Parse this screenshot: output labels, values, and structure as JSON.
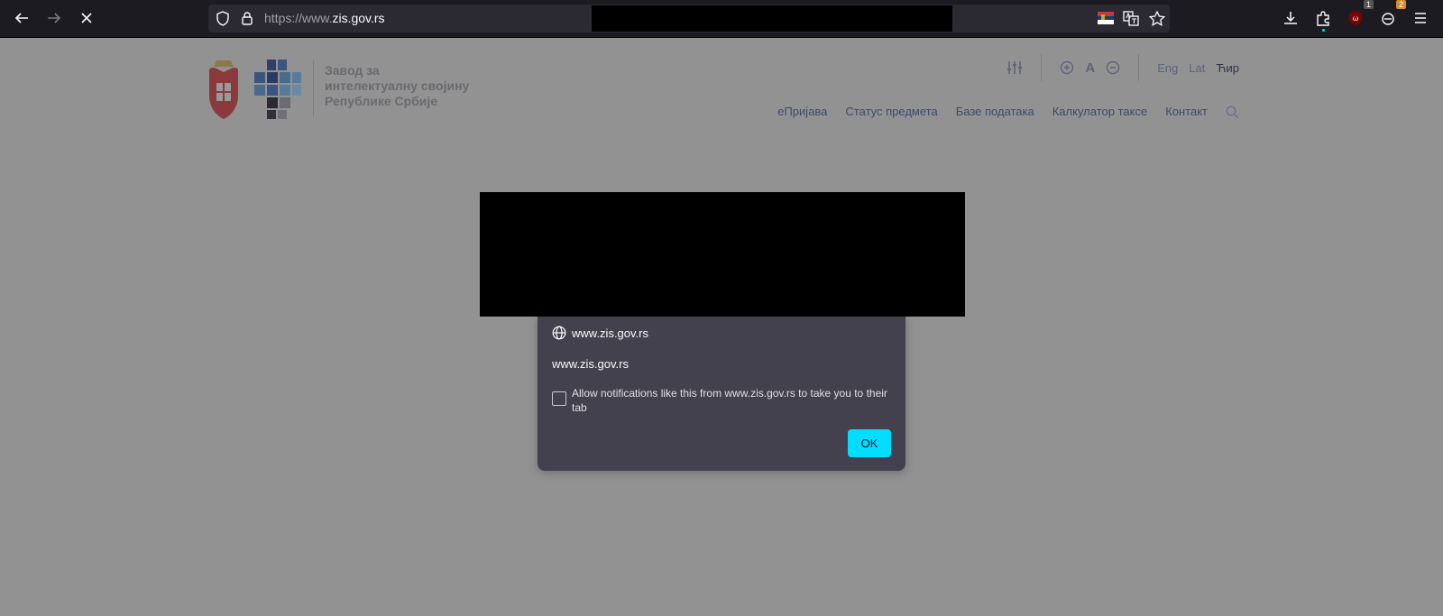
{
  "browser": {
    "url_scheme": "https://www.",
    "url_domain": "zis.gov.rs",
    "extension_badges": [
      "1",
      "2"
    ]
  },
  "site": {
    "logo_lines": [
      "Завод за",
      "интелектуалну својину",
      "Републике Србије"
    ],
    "nav_items": [
      "еПријава",
      "Статус предмета",
      "Базе података",
      "Калкулатор таксе",
      "Контакт"
    ],
    "font_size_label": "A",
    "languages": [
      "Eng",
      "Lat",
      "Ћир"
    ],
    "active_language": "Ћир"
  },
  "dialog": {
    "origin": "www.zis.gov.rs",
    "message": "www.zis.gov.rs",
    "checkbox_label": "Allow notifications like this from www.zis.gov.rs to take you to their tab",
    "checkbox_checked": false,
    "ok_label": "OK"
  },
  "colors": {
    "ok_button": "#00ddff",
    "dialog_bg": "#42414d",
    "toolbar_bg": "#1c1b22",
    "page_overlay": "#929292"
  }
}
